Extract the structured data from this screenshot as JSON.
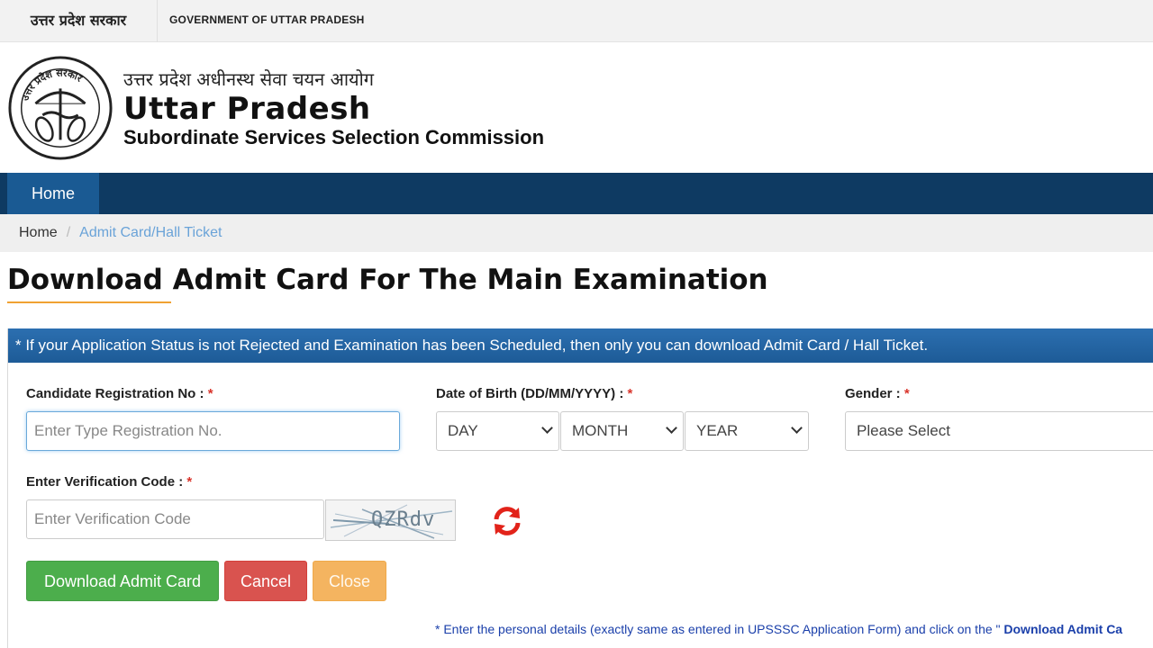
{
  "gov_bar": {
    "hindi": "उत्तर प्रदेश सरकार",
    "english": "GOVERNMENT OF UTTAR PRADESH"
  },
  "header": {
    "hindi_name": "उत्तर प्रदेश अधीनस्थ सेवा चयन आयोग",
    "title": "Uttar Pradesh",
    "subtitle": "Subordinate Services Selection Commission",
    "emblem_text": "उत्तर प्रदेश सरकार"
  },
  "nav": {
    "home": "Home"
  },
  "breadcrumb": {
    "home": "Home",
    "separator": "/",
    "current": "Admit Card/Hall Ticket"
  },
  "page": {
    "title": "Download Admit Card For The Main Examination"
  },
  "panel": {
    "notice": "* If your Application Status is not Rejected and Examination has been Scheduled, then only you can download Admit Card / Hall Ticket.",
    "registration": {
      "label": "Candidate Registration No :",
      "placeholder": "Enter Type Registration No."
    },
    "dob": {
      "label": "Date of Birth (DD/MM/YYYY) :",
      "day": "DAY",
      "month": "MONTH",
      "year": "YEAR"
    },
    "gender": {
      "label": "Gender :",
      "value": "Please Select"
    },
    "verification": {
      "label": "Enter Verification Code :",
      "placeholder": "Enter Verification Code",
      "captcha": "QZRdv"
    },
    "required_mark": "*",
    "buttons": {
      "download": "Download Admit Card",
      "cancel": "Cancel",
      "close": "Close"
    },
    "note_prefix": "* Enter the personal details (exactly same as entered in UPSSSC Application Form) and click on the \"",
    "note_bold": " Download Admit Ca"
  },
  "colors": {
    "nav_bg": "#0e3a62",
    "nav_active": "#1a5a93",
    "panel_header": "#2c6fb0",
    "accent_underline": "#f0a232",
    "required": "#d9342b",
    "btn_download": "#4cae4c",
    "btn_cancel": "#d9534f",
    "btn_close": "#f4b460"
  }
}
